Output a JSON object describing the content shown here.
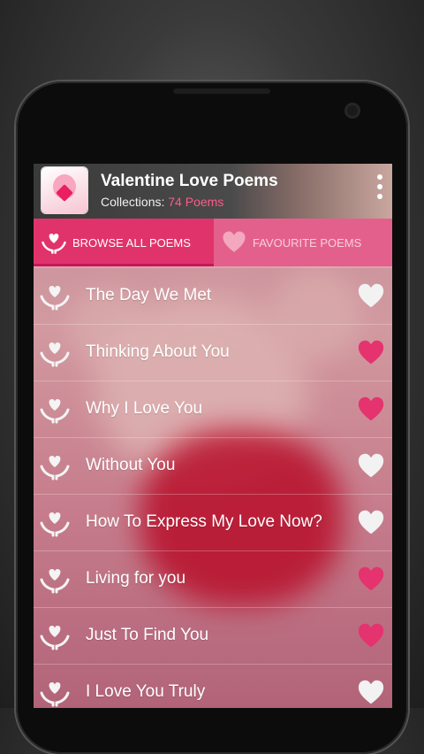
{
  "header": {
    "title": "Valentine Love Poems",
    "subtitle_prefix": "Collections:",
    "subtitle_count": "74 Poems"
  },
  "tabs": [
    {
      "label": "BROWSE ALL POEMS",
      "active": true
    },
    {
      "label": "FAVOURITE POEMS",
      "active": false
    }
  ],
  "poems": [
    {
      "title": "The Day We Met",
      "favourite": false
    },
    {
      "title": "Thinking About You",
      "favourite": true
    },
    {
      "title": "Why I Love You",
      "favourite": true
    },
    {
      "title": "Without You",
      "favourite": false
    },
    {
      "title": "How To Express My Love Now?",
      "favourite": false
    },
    {
      "title": "Living for you",
      "favourite": true
    },
    {
      "title": "Just To Find You",
      "favourite": true
    },
    {
      "title": "I Love You Truly",
      "favourite": false
    }
  ],
  "colors": {
    "accent": "#e0336c",
    "favourite_on": "#e5336f",
    "favourite_off": "#f2f2f2",
    "count_text": "#ff5a8a"
  }
}
